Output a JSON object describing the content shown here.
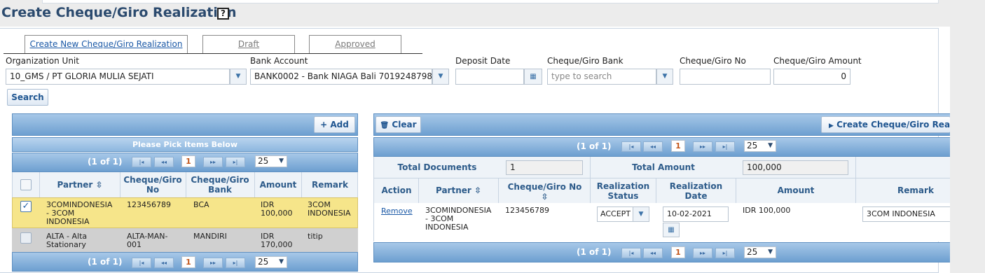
{
  "page": {
    "title": "Create Cheque/Giro Realization",
    "help_icon": "?"
  },
  "tabs": [
    {
      "label": "Create New Cheque/Giro Realization",
      "active": true
    },
    {
      "label": "Draft",
      "active": false
    },
    {
      "label": "Approved",
      "active": false
    }
  ],
  "filters": {
    "org_unit_label": "Organization Unit",
    "org_unit_value": "10_GMS / PT GLORIA MULIA SEJATI",
    "bank_account_label": "Bank Account",
    "bank_account_value": "BANK0002 - Bank NIAGA Bali 7019248798",
    "deposit_date_label": "Deposit Date",
    "deposit_date_value": "",
    "cheque_bank_label": "Cheque/Giro Bank",
    "cheque_bank_placeholder": "type to search",
    "cheque_no_label": "Cheque/Giro No",
    "cheque_no_value": "",
    "cheque_amount_label": "Cheque/Giro Amount",
    "cheque_amount_value": "0",
    "search_button": "Search"
  },
  "left_grid": {
    "add_button": "+ Add",
    "caption": "Please Pick Items Below",
    "pager": {
      "info": "(1 of 1)",
      "page": "1",
      "page_size": "25",
      "first": "|◂",
      "prev": "◂◂",
      "next": "▸▸",
      "last": "▸|"
    },
    "columns": [
      "Partner ⇳",
      "Cheque/Giro No",
      "Cheque/Giro Bank",
      "Amount",
      "Remark"
    ],
    "columns_lines": [
      [
        "Partner ⇳"
      ],
      [
        "Cheque/Giro",
        "No"
      ],
      [
        "Cheque/Giro",
        "Bank"
      ],
      [
        "Amount"
      ],
      [
        "Remark"
      ]
    ],
    "rows": [
      {
        "checked": true,
        "partner": [
          "3COMINDONESIA",
          "- 3COM",
          "INDONESIA"
        ],
        "cheque_no": "123456789",
        "bank": "BCA",
        "amount": [
          "IDR",
          "100,000"
        ],
        "remark": [
          "3COM",
          "INDONESIA"
        ]
      },
      {
        "checked": false,
        "partner": [
          "ALTA - Alta",
          "Stationary"
        ],
        "cheque_no": [
          "ALTA-MAN-",
          "001"
        ],
        "bank": "MANDIRI",
        "amount": [
          "IDR",
          "170,000"
        ],
        "remark": [
          "titip"
        ]
      }
    ]
  },
  "right_grid": {
    "clear_button": "Clear",
    "create_button": "Create Cheque/Giro Realizat",
    "pager": {
      "info": "(1 of 1)",
      "page": "1",
      "page_size": "25",
      "first": "|◂",
      "prev": "◂◂",
      "next": "▸▸",
      "last": "▸|"
    },
    "total_documents_label": "Total Documents",
    "total_documents_value": "1",
    "total_amount_label": "Total Amount",
    "total_amount_value": "100,000",
    "columns": {
      "action": "Action",
      "partner": "Partner ⇳",
      "cheque_no": "Cheque/Giro No",
      "cheque_no_sort": "⇳",
      "status_1": "Realization",
      "status_2": "Status",
      "date_1": "Realization",
      "date_2": "Date",
      "amount": "Amount",
      "remark": "Remark"
    },
    "rows": [
      {
        "action": "Remove",
        "partner": [
          "3COMINDONESIA",
          "- 3COM",
          "INDONESIA"
        ],
        "cheque_no": "123456789",
        "status": "ACCEPT",
        "date": "10-02-2021",
        "amount": "IDR 100,000",
        "remark": "3COM INDONESIA"
      }
    ]
  },
  "colors": {
    "accent": "#1a58a6",
    "header_bar": "#7aa9d6",
    "selected_row": "#f6e58a",
    "alt_row": "#d0d0d0"
  }
}
